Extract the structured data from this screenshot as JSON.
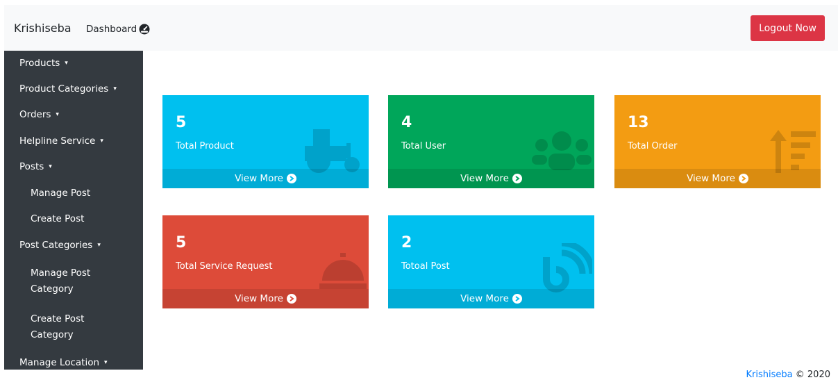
{
  "navbar": {
    "brand": "Krishiseba",
    "dashboard_label": "Dashboard",
    "logout_label": "Logout Now",
    "logout_color": "#dc3545"
  },
  "sidebar": {
    "items": [
      {
        "label": "Products",
        "caret": "▾"
      },
      {
        "label": "Product Categories",
        "caret": "▾"
      },
      {
        "label": "Orders",
        "caret": "▾"
      },
      {
        "label": "Helpline Service",
        "caret": "▾"
      },
      {
        "label": "Posts",
        "caret": "▾"
      },
      {
        "label": "Manage Post"
      },
      {
        "label": "Create Post"
      },
      {
        "label": "Post Categories",
        "caret": "▾"
      },
      {
        "label": "Manage Post Category"
      },
      {
        "label": "Create Post Category"
      },
      {
        "label": "Manage Location",
        "caret": "▾"
      }
    ]
  },
  "cards": [
    {
      "value": "5",
      "label": "Total Product",
      "more": "View More",
      "color": "#00c0ef",
      "icon": "tractor-icon"
    },
    {
      "value": "4",
      "label": "Total User",
      "more": "View More",
      "color": "#00a65a",
      "icon": "users-icon"
    },
    {
      "value": "13",
      "label": "Total Order",
      "more": "View More",
      "color": "#f39c12",
      "icon": "sort-amount-up-icon"
    },
    {
      "value": "5",
      "label": "Total Service Request",
      "more": "View More",
      "color": "#dd4b39",
      "icon": "concierge-bell-icon"
    },
    {
      "value": "2",
      "label": "Totoal Post",
      "more": "View More",
      "color": "#00c0ef",
      "icon": "blog-icon"
    }
  ],
  "footer": {
    "brand": "Krishiseba",
    "copyright": "© 2020"
  }
}
